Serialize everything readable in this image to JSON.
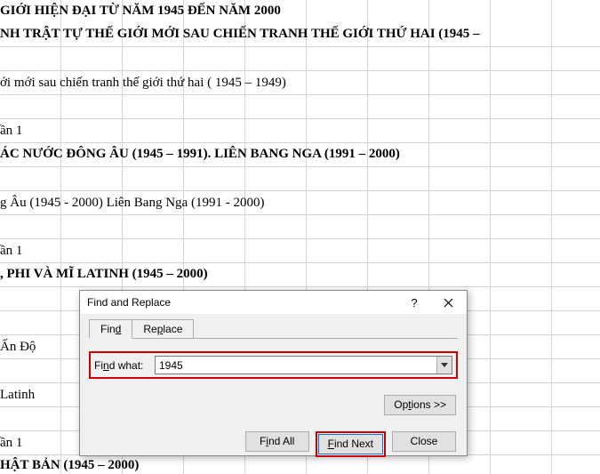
{
  "cells": {
    "r1": "GIỚI HIỆN ĐẠI TỪ NĂM 1945 ĐẾN NĂM 2000",
    "r2": "NH TRẬT TỰ THẾ GIỚI MỚI SAU CHIẾN TRANH THẾ GIỚI THỨ HAI (1945 –",
    "r4": "ới mới sau chiến tranh thế giới thứ hai ( 1945 – 1949)",
    "r6": "ần 1",
    "r7": "ÁC NƯỚC ĐÔNG ÂU (1945 – 1991). LIÊN BANG NGA (1991 – 2000)",
    "r9": "g Âu (1945 - 2000) Liên Bang Nga (1991 - 2000)",
    "r11": "ần 1",
    "r12": ", PHI VÀ MĨ LATINH (1945 – 2000)",
    "r14": "Ấn Độ",
    "r16": "Latinh",
    "r18": "ần 1",
    "r19": "HẬT BẢN (1945 – 2000)"
  },
  "dialog": {
    "title": "Find and Replace",
    "tab_find": "Find",
    "tab_find_ul": "d",
    "tab_replace": "Replace",
    "tab_replace_ul": "p",
    "find_what_pre": "Fi",
    "find_what_ul": "n",
    "find_what_post": "d what:",
    "find_value": "1945",
    "options_pre": "Op",
    "options_ul": "t",
    "options_post": "ions >>",
    "find_all_pre": "F",
    "find_all_ul": "i",
    "find_all_post": "nd All",
    "find_next_ul": "F",
    "find_next_post": "ind Next",
    "close": "Close"
  },
  "colors": {
    "highlight": "#c00",
    "grid": "#d4d4d4"
  }
}
